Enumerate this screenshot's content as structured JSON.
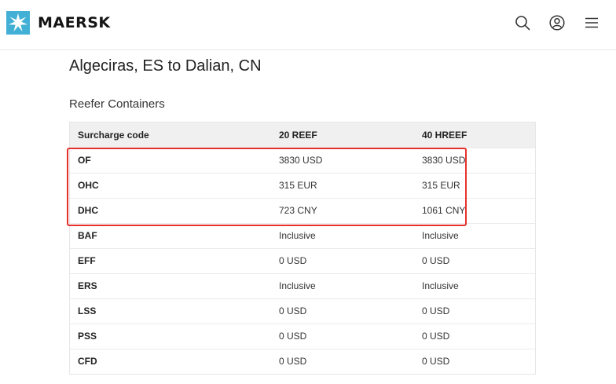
{
  "brand": {
    "name": "MAERSK",
    "color": "#42b0d5"
  },
  "header_icons": [
    "search-icon",
    "user-account-icon",
    "menu-icon"
  ],
  "page": {
    "route_title": "Algeciras, ES to Dalian, CN",
    "section_title": "Reefer Containers"
  },
  "table": {
    "columns": [
      "Surcharge code",
      "20 REEF",
      "40 HREEF"
    ],
    "rows": [
      {
        "code": "OF",
        "c20": "3830 USD",
        "c40": "3830 USD"
      },
      {
        "code": "OHC",
        "c20": "315 EUR",
        "c40": "315 EUR"
      },
      {
        "code": "DHC",
        "c20": "723 CNY",
        "c40": "1061 CNY"
      },
      {
        "code": "BAF",
        "c20": "Inclusive",
        "c40": "Inclusive"
      },
      {
        "code": "EFF",
        "c20": "0 USD",
        "c40": "0 USD"
      },
      {
        "code": "ERS",
        "c20": "Inclusive",
        "c40": "Inclusive"
      },
      {
        "code": "LSS",
        "c20": "0 USD",
        "c40": "0 USD"
      },
      {
        "code": "PSS",
        "c20": "0 USD",
        "c40": "0 USD"
      },
      {
        "code": "CFD",
        "c20": "0 USD",
        "c40": "0 USD"
      }
    ]
  },
  "annotation": {
    "highlight_color": "#e5322d"
  }
}
